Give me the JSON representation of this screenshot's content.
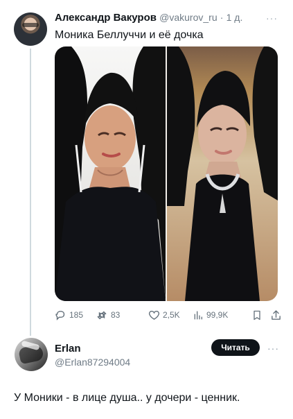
{
  "tweet": {
    "author_name": "Александр Вакуров",
    "handle": "@vakurov_ru",
    "separator": "·",
    "time": "1 д.",
    "more": "···",
    "text": "Моника Беллуччи и её дочка",
    "stats": {
      "replies": "185",
      "retweets": "83",
      "likes": "2,5K",
      "views": "99,9K"
    },
    "icons": {
      "reply": "reply-icon",
      "retweet": "retweet-icon",
      "like": "heart-icon",
      "views": "views-icon",
      "bookmark": "bookmark-icon",
      "share": "share-icon"
    }
  },
  "reply": {
    "author_name": "Erlan",
    "handle": "@Erlan87294004",
    "button_label": "Читать",
    "more": "···",
    "text": "У Моники - в лице душа.. у дочери - ценник."
  },
  "colors": {
    "text": "#0f1419",
    "secondary": "#6f7b86",
    "button_bg": "#0f1419",
    "thread_line": "#cfd9de"
  }
}
